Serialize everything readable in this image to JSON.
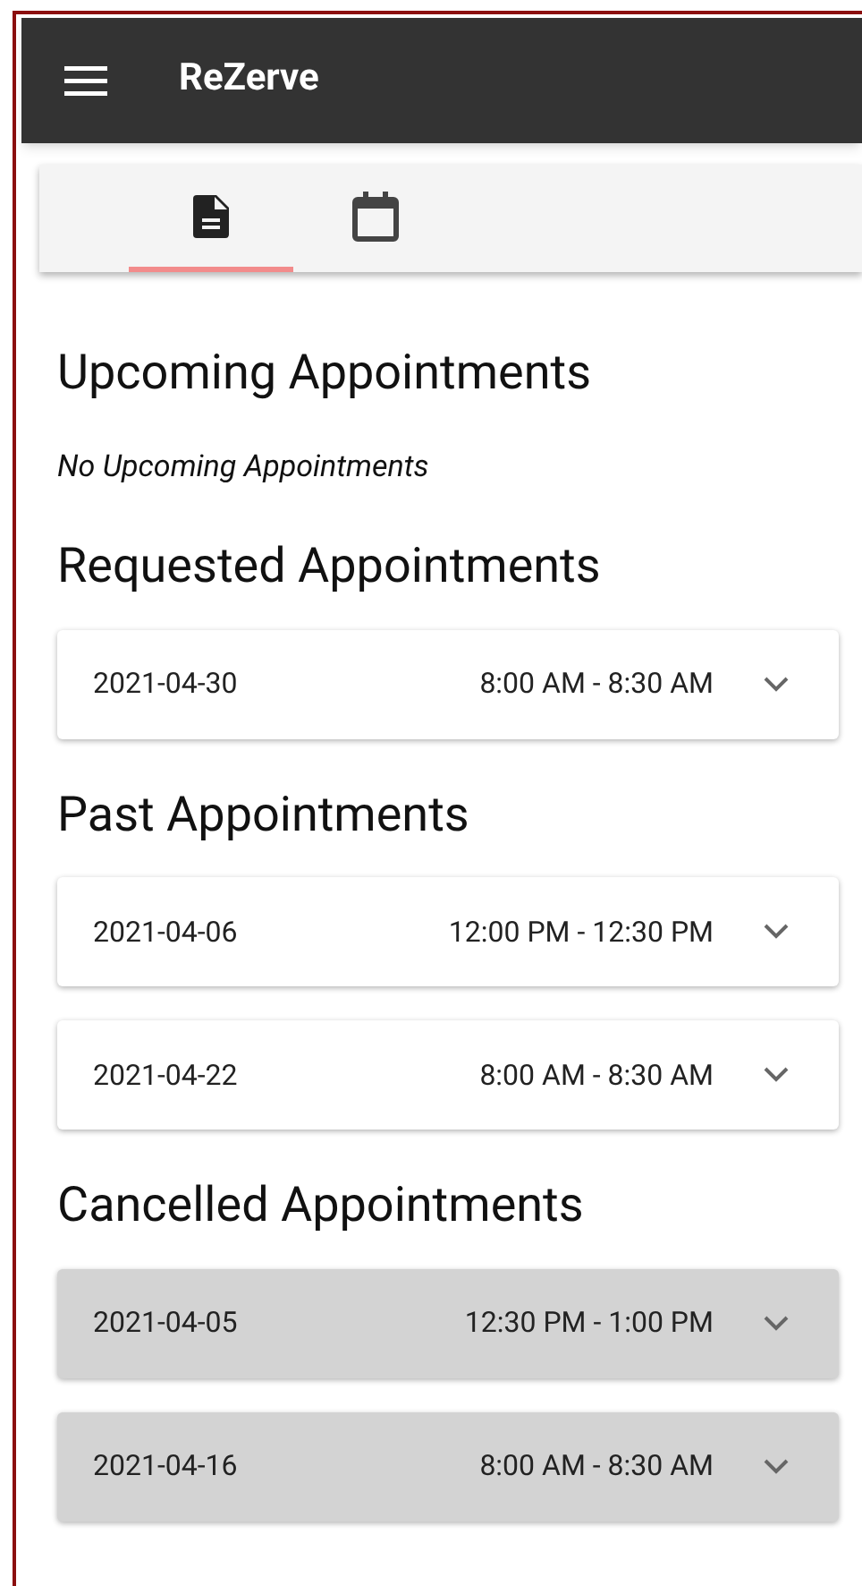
{
  "app_bar": {
    "title": "ReZerve"
  },
  "tabs": [
    {
      "kind": "document",
      "selected": true
    },
    {
      "kind": "calendar",
      "selected": false
    }
  ],
  "sections": [
    {
      "title": "Upcoming Appointments",
      "empty_message": "No Upcoming Appointments"
    },
    {
      "title": "Requested Appointments",
      "appointments": [
        {
          "date": "2021-04-30",
          "time": "8:00 AM - 8:30 AM",
          "cancelled": false
        }
      ]
    },
    {
      "title": "Past Appointments",
      "appointments": [
        {
          "date": "2021-04-06",
          "time": "12:00 PM - 12:30 PM",
          "cancelled": false
        },
        {
          "date": "2021-04-22",
          "time": "8:00 AM - 8:30 AM",
          "cancelled": false
        }
      ]
    },
    {
      "title": "Cancelled Appointments",
      "appointments": [
        {
          "date": "2021-04-05",
          "time": "12:30 PM - 1:00 PM",
          "cancelled": true
        },
        {
          "date": "2021-04-16",
          "time": "8:00 AM - 8:30 AM",
          "cancelled": true
        }
      ]
    }
  ]
}
